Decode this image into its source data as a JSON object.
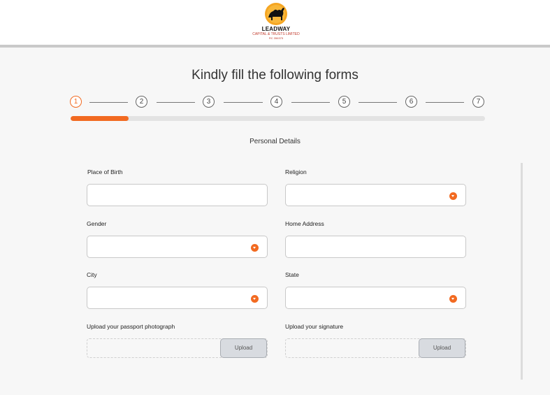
{
  "logo": {
    "brand": "LEADWAY",
    "subtitle": "CAPITAL & TRUSTS LIMITED",
    "rc": "RC 356375",
    "colors": {
      "ring": "#f5a623",
      "camel": "#111111",
      "text_red": "#c0392b"
    }
  },
  "title": "Kindly fill the following forms",
  "stepper": {
    "steps": [
      "1",
      "2",
      "3",
      "4",
      "5",
      "6",
      "7"
    ],
    "active_step": 1
  },
  "progress": {
    "fraction": 0.14
  },
  "section_title": "Personal Details",
  "fields": {
    "place_of_birth": {
      "label": "Place of Birth",
      "value": ""
    },
    "religion": {
      "label": "Religion",
      "value": "",
      "icon": "chevron-down-icon"
    },
    "gender": {
      "label": "Gender",
      "value": "",
      "icon": "chevron-down-icon"
    },
    "home_address": {
      "label": "Home Address",
      "value": ""
    },
    "city": {
      "label": "City",
      "value": "",
      "icon": "chevron-down-icon"
    },
    "state": {
      "label": "State",
      "value": "",
      "icon": "chevron-down-icon"
    },
    "passport": {
      "label": "Upload your passport photograph",
      "button": "Upload"
    },
    "signature": {
      "label": "Upload your signature",
      "button": "Upload"
    }
  },
  "colors": {
    "accent": "#f26a21",
    "track": "#e3e3e3"
  }
}
